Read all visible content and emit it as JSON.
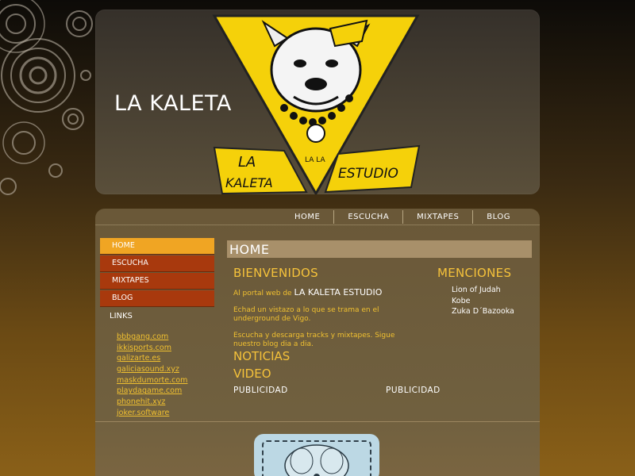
{
  "site": {
    "title": "LA KALETA"
  },
  "logo": {
    "line1": "LA",
    "line2": "KALETA",
    "line3": "ESTUDIO",
    "mid": "LA LA",
    "icon": "pitbull-logo"
  },
  "topnav": {
    "items": [
      "HOME",
      "ESCUCHA",
      "MIXTAPES",
      "BLOG"
    ]
  },
  "sidenav": {
    "items": [
      "HOME",
      "ESCUCHA",
      "MIXTAPES",
      "BLOG"
    ],
    "active": "HOME"
  },
  "links": {
    "title": "LINKS",
    "items": [
      "bbbgang.com",
      "ikkisports.com",
      "galizarte.es",
      "galiciasound.xyz",
      "maskdumorte.com",
      "playdagame.com",
      "phonehit.xyz",
      "joker.software"
    ]
  },
  "content": {
    "page_header": "HOME",
    "bienvenidos": "BIENVENIDOS",
    "intro_prefix": "Al portal web de ",
    "intro_name": "LA KALETA ESTUDIO",
    "p2": "Echad un vistazo a lo que se trama en el underground de Vigo.",
    "p3": "Escucha y descarga tracks y mixtapes. Sigue nuestro blog dia a dia.",
    "noticias": "NOTICIAS",
    "video": "VIDEO",
    "publicidad_1": "PUBLICIDAD",
    "publicidad_2": "PUBLICIDAD"
  },
  "menciones": {
    "title": "MENCIONES",
    "items": [
      "Lion of Judah",
      "Kobe",
      "Zuka D´Bazooka"
    ]
  },
  "colors": {
    "accent": "#f0a523",
    "nav": "#a8390d",
    "link": "#f0c030",
    "heading": "#f5c23a"
  }
}
